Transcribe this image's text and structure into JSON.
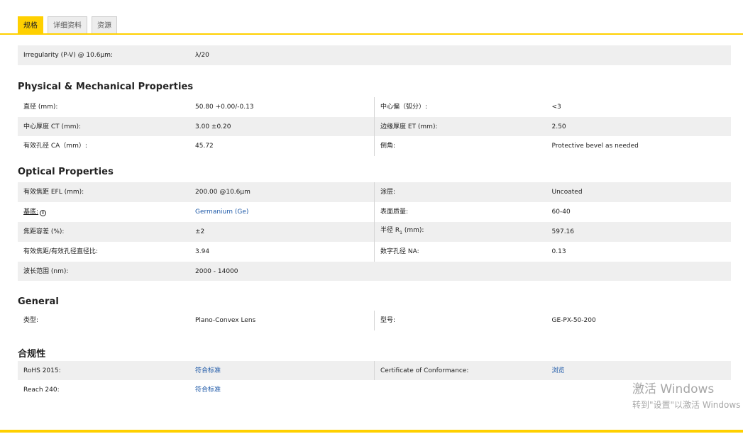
{
  "tabs": [
    "规格",
    "详细资料",
    "资源"
  ],
  "top_rows": [
    {
      "label": "Irregularity (P-V) @ 10.6μm:",
      "value": "λ/20"
    }
  ],
  "sections": {
    "physical": {
      "title": "Physical & Mechanical Properties",
      "rows": [
        {
          "l1": "直径 (mm):",
          "v1": "50.80 +0.00/-0.13",
          "l2": "中心偏（弧分）:",
          "v2": "<3"
        },
        {
          "l1": "中心厚度 CT (mm):",
          "v1": "3.00 ±0.20",
          "l2": "边缘厚度 ET (mm):",
          "v2": "2.50"
        },
        {
          "l1": "有效孔径 CA（mm）:",
          "v1": "45.72",
          "l2": "倒角:",
          "v2": "Protective bevel as needed"
        }
      ]
    },
    "optical": {
      "title": "Optical Properties",
      "rows": [
        {
          "l1": "有效焦距 EFL (mm):",
          "v1": "200.00 @10.6μm",
          "l2": "涂层:",
          "v2": "Uncoated"
        },
        {
          "l1": "基底:",
          "v1": "Germanium (Ge)",
          "l2": "表面质量:",
          "v2": "60-40"
        },
        {
          "l1": "焦距容差 (%):",
          "v1": "±2",
          "l2": "半径 R",
          "l2sub": "1",
          "l2tail": " (mm):",
          "v2": "597.16"
        },
        {
          "l1": "有效焦距/有效孔径直径比:",
          "v1": "3.94",
          "l2": "数字孔径 NA:",
          "v2": "0.13"
        },
        {
          "l1": "波长范围 (nm):",
          "v1": "2000 - 14000"
        }
      ]
    },
    "general": {
      "title": "General",
      "rows": [
        {
          "l1": "类型:",
          "v1": "Plano-Convex Lens",
          "l2": "型号:",
          "v2": "GE-PX-50-200"
        }
      ]
    },
    "compliance": {
      "title": "合规性",
      "rows": [
        {
          "l1": "RoHS 2015:",
          "v1": "符合标准",
          "l2": "Certificate of Conformance:",
          "v2": "浏览"
        },
        {
          "l1": "Reach 240:",
          "v1": "符合标准"
        }
      ]
    }
  },
  "info_icon_glyph": "i",
  "watermark": {
    "line1": "激活 Windows",
    "line2": "转到\"设置\"以激活 Windows"
  },
  "colors": {
    "accent": "#ffd000",
    "link": "#1f5aa8",
    "row_alt": "#efefef"
  }
}
